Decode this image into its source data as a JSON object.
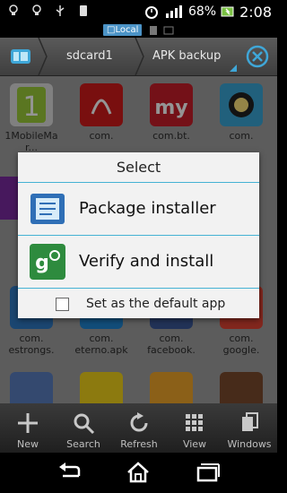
{
  "status_bar": {
    "battery_percent": "68%",
    "time": "2:08",
    "local_label": "Local"
  },
  "toolbar": {
    "crumbs": [
      "sdcard1",
      "APK backup"
    ]
  },
  "files": [
    {
      "label": "1MobileMa\nr..."
    },
    {
      "label": "com."
    },
    {
      "label": "com.bt."
    },
    {
      "label": "com."
    },
    {
      "label": "com.\nestrongs."
    },
    {
      "label": "com.\neterno.apk"
    },
    {
      "label": "com.\nfacebook."
    },
    {
      "label": "com.\ngoogle."
    }
  ],
  "dialog": {
    "title": "Select",
    "options": [
      "Package installer",
      "Verify and install"
    ],
    "default_checkbox_label": "Set as the default app",
    "default_checked": false
  },
  "bottom_bar": [
    "New",
    "Search",
    "Refresh",
    "View",
    "Windows"
  ]
}
